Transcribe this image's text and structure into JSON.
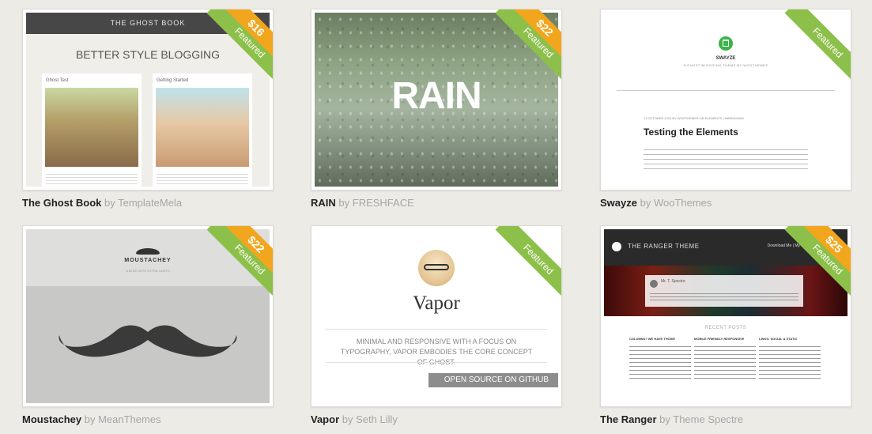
{
  "themes": [
    {
      "name": "The Ghost Book",
      "author": "by TemplateMela",
      "featured_label": "Featured",
      "price": "$16",
      "preview": {
        "bar_text": "THE GHOST BOOK",
        "headline": "BETTER STYLE BLOGGING",
        "col1_title": "Ghost Test",
        "col2_title": "Getting Started"
      }
    },
    {
      "name": "RAIN",
      "author": "by FRESHFACE",
      "featured_label": "Featured",
      "price": "$22",
      "preview": {
        "title": "RAIN"
      }
    },
    {
      "name": "Swayze",
      "author": "by WooThemes",
      "featured_label": "Featured",
      "preview": {
        "site_name": "SWAYZE",
        "tagline": "A GHOST BLOGGING THEME BY WOOTHEMES",
        "meta": "17 OCTOBER 2013 BY WOOTHEMES ON ELEMENTS | MARKDOWN",
        "post_title": "Testing the Elements"
      }
    },
    {
      "name": "Moustachey",
      "author": "by MeanThemes",
      "featured_label": "Featured",
      "price": "$22",
      "preview": {
        "site_name": "MOUSTACHEY",
        "tagline": "A BLOG WITH EXTRA GUSTO"
      }
    },
    {
      "name": "Vapor",
      "author": "by Seth Lilly",
      "featured_label": "Featured",
      "preview": {
        "title": "Vapor",
        "description": "MINIMAL AND RESPONSIVE WITH A FOCUS ON TYPOGRAPHY, VAPOR EMBODIES THE CORE CONCEPT OF GHOST.",
        "button": "OPEN SOURCE ON GITHUB"
      }
    },
    {
      "name": "The Ranger",
      "author": "by Theme Spectre",
      "featured_label": "Featured",
      "price": "$25",
      "preview": {
        "brand": "THE RANGER THEME",
        "nav": "Download Me | My",
        "author_name": "Mr. T. Spectre",
        "recent": "RECENT POSTS",
        "col1": "COLUMNS? WE HAVE THOSE!",
        "col2": "MOBILE FRIENDLY RESPONSIVE",
        "col3": "LINKS: SOCIAL & STATIC"
      }
    }
  ],
  "colors": {
    "featured": "#8dc04a",
    "price": "#f2a61d",
    "background": "#ecebe6"
  }
}
